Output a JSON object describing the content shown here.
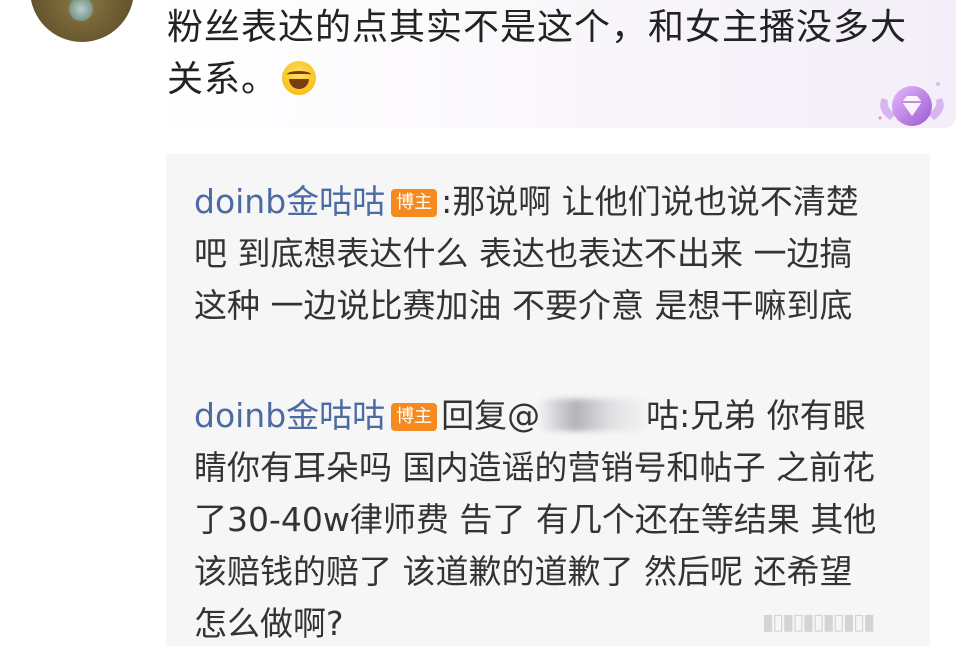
{
  "comment": {
    "text": "粉丝表达的点其实不是这个，和女主播没多大关系。",
    "emoji_name": "laughing-tears-emoji"
  },
  "badge": {
    "icon": "diamond-badge-icon",
    "color": "#b06ad8"
  },
  "replies": [
    {
      "user": "doinb金咕咕",
      "tag": "博主",
      "text": ":那说啊 让他们说也说不清楚吧 到底想表达什么 表达也表达不出来 一边搞这种 一边说比赛加油 不要介意 是想干嘛到底"
    },
    {
      "user": "doinb金咕咕",
      "tag": "博主",
      "reply_prefix": "回复@",
      "mention_suffix": "咕",
      "text": ":兄弟 你有眼睛你有耳朵吗 国内造谣的营销号和帖子 之前花了30-40w律师费 告了 有几个还在等结果 其他该赔钱的赔了 该道歉的道歉了 然后呢 还希望怎么做啊?"
    }
  ],
  "colors": {
    "username": "#4b6ba3",
    "tag_bg": "#f58a1f",
    "reply_bg": "#f6f6f6"
  }
}
